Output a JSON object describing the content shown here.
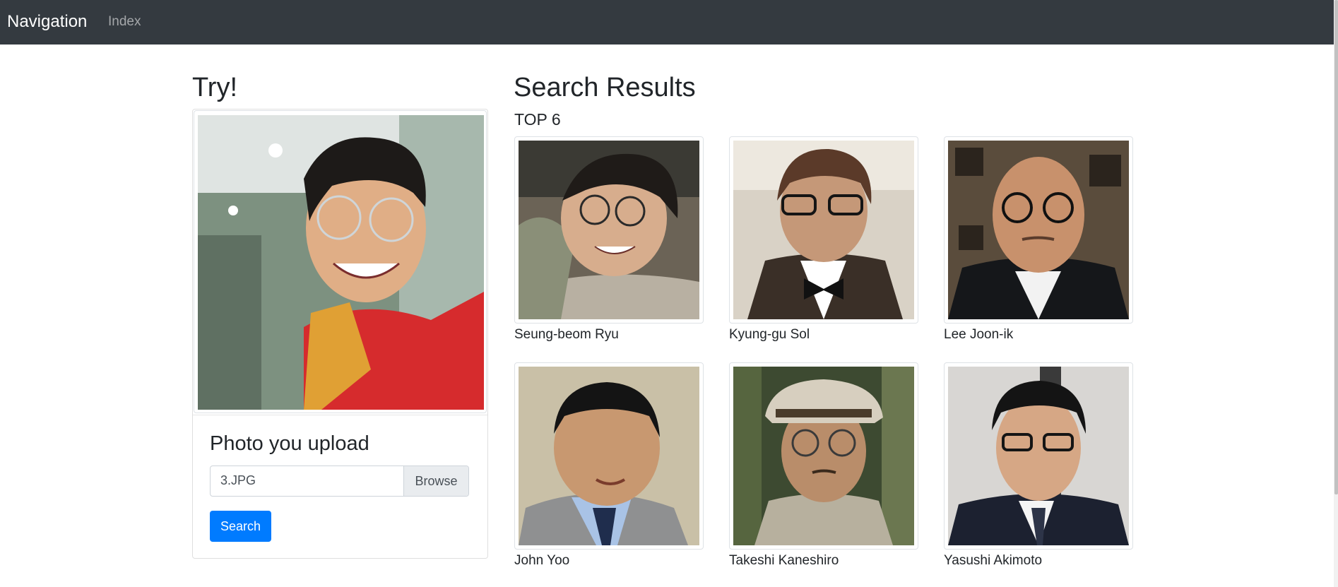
{
  "nav": {
    "brand": "Navigation",
    "link": "Index"
  },
  "left": {
    "title": "Try!",
    "upload_title": "Photo you upload",
    "file_value": "3.JPG",
    "browse_label": "Browse",
    "search_label": "Search"
  },
  "results": {
    "title": "Search Results",
    "subtitle": "TOP 6",
    "items": [
      {
        "name": "Seung-beom Ryu"
      },
      {
        "name": "Kyung-gu Sol"
      },
      {
        "name": "Lee Joon-ik"
      },
      {
        "name": "John Yoo"
      },
      {
        "name": "Takeshi Kaneshiro"
      },
      {
        "name": "Yasushi Akimoto"
      }
    ]
  },
  "colors": {
    "navbar_bg": "#343a40",
    "primary": "#007bff",
    "text": "#212529"
  }
}
